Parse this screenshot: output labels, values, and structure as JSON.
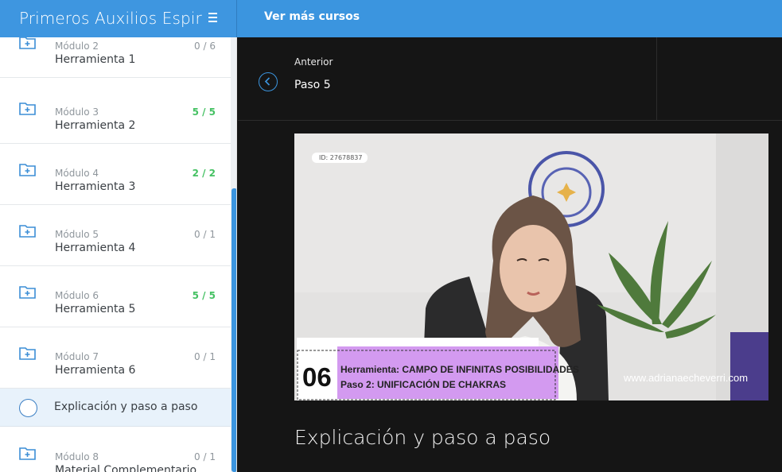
{
  "header": {
    "brand_title": "Primeros Auxilios Espir",
    "more_courses": "Ver más cursos"
  },
  "sidebar": {
    "modules": [
      {
        "module": "Módulo 2",
        "name": "Herramienta 1",
        "progress": "0 / 6",
        "done": false
      },
      {
        "module": "Módulo 3",
        "name": "Herramienta 2",
        "progress": "5 / 5",
        "done": true
      },
      {
        "module": "Módulo 4",
        "name": "Herramienta 3",
        "progress": "2 / 2",
        "done": true
      },
      {
        "module": "Módulo 5",
        "name": "Herramienta 4",
        "progress": "0 / 1",
        "done": false
      },
      {
        "module": "Módulo 6",
        "name": "Herramienta 5",
        "progress": "5 / 5",
        "done": true
      },
      {
        "module": "Módulo 7",
        "name": "Herramienta 6",
        "progress": "0 / 1",
        "done": false
      },
      {
        "module": "Módulo 8",
        "name": "Material Complementario",
        "progress": "0 / 1",
        "done": false
      }
    ],
    "current_lesson": "Explicación y paso a paso"
  },
  "navigation": {
    "previous_label": "Anterior",
    "previous_title": "Paso 5"
  },
  "video": {
    "id_tag": "ID: 27678837",
    "step_number": "06",
    "caption_line1": "Herramienta: CAMPO DE INFINITAS POSIBILIDADES",
    "caption_line2": "Paso 2:  UNIFICACIÓN DE CHAKRAS",
    "watermark": "www.adrianaecheverri.com"
  },
  "lesson_title": "Explicación y paso a paso",
  "colors": {
    "accent": "#3b95df",
    "done": "#45c163",
    "caption_bg": "#d39af0"
  }
}
